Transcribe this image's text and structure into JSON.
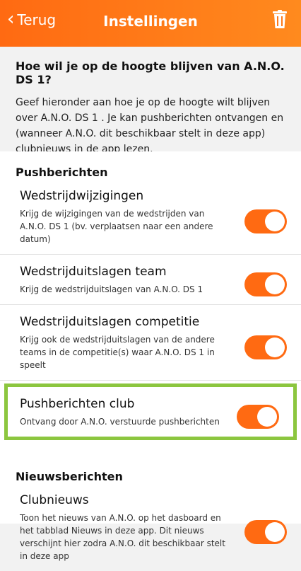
{
  "header": {
    "back_label": "Terug",
    "title": "Instellingen",
    "back_icon": "chevron-left-icon",
    "trash_icon": "trash-icon"
  },
  "intro": {
    "title": "Hoe wil je op de hoogte blijven van A.N.O. DS 1?",
    "text": "Geef hieronder aan hoe je op de hoogte wilt blijven over A.N.O. DS 1 . Je kan pushberichten ontvangen en (wanneer A.N.O. dit beschikbaar stelt in deze app) clubnieuws in de app lezen."
  },
  "push": {
    "section_title": "Pushberichten",
    "items": [
      {
        "title": "Wedstrijdwijzigingen",
        "desc": "Krijg de wijzigingen van de wedstrijden van A.N.O. DS 1 (bv. verplaatsen naar een andere datum)",
        "on": true
      },
      {
        "title": "Wedstrijduitslagen team",
        "desc": "Krijg de wedstrijduitslagen van A.N.O. DS 1",
        "on": true
      },
      {
        "title": "Wedstrijduitslagen competitie",
        "desc": "Krijg ook de wedstrijduitslagen van de andere teams in de competitie(s) waar A.N.O. DS 1 in speelt",
        "on": true
      },
      {
        "title": "Pushberichten club",
        "desc": "Ontvang door A.N.O. verstuurde pushberichten",
        "on": true
      }
    ]
  },
  "news": {
    "section_title": "Nieuwsberichten",
    "items": [
      {
        "title": "Clubnieuws",
        "desc": "Toon het nieuws van A.N.O. op het dasboard en het tabblad Nieuws in deze app. Dit nieuws verschijnt hier zodra A.N.O. dit beschikbaar stelt in deze app",
        "on": true
      }
    ]
  },
  "colors": {
    "accent": "#ff6a12",
    "highlight": "#8cc63f"
  }
}
